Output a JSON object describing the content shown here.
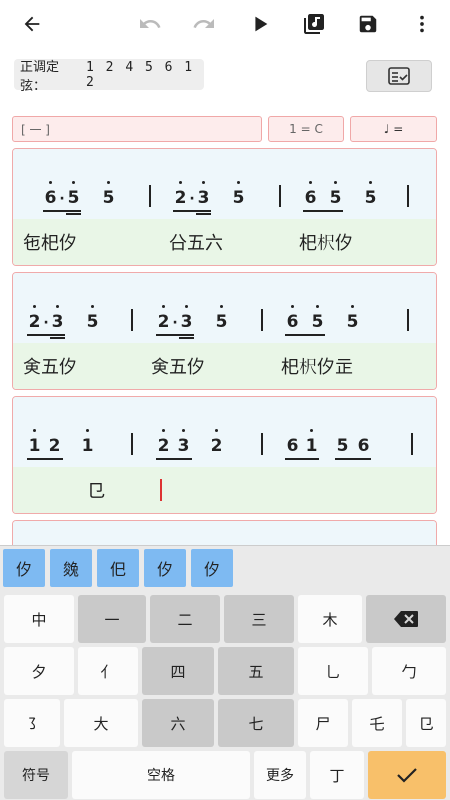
{
  "toolbar": {
    "back_icon": "arrow-back-icon",
    "undo_icon": "undo-icon",
    "redo_icon": "redo-icon",
    "play_icon": "play-icon",
    "music_library_icon": "music-library-icon",
    "save_icon": "save-icon",
    "more_icon": "more-vert-icon"
  },
  "tuning": {
    "label": "正调定弦：",
    "notes": "1 2 4 5 6 1 2"
  },
  "header": {
    "section": "[ 一 ]",
    "key": "1 = C",
    "tempo": "♩ ="
  },
  "measures": [
    {
      "jianpu": [
        "6·5 5",
        "2·3 5",
        "6 5 5"
      ],
      "lyrics": [
        "㐌𣏌㐴",
        "㕣五六",
        "𣏌𣏧㐴"
      ]
    },
    {
      "jianpu": [
        "2·3 5",
        "2·3 5",
        "6 5 5"
      ],
      "lyrics": [
        "㑒五㐴",
        "㑒五㐴",
        "𣏌𣏧㐴㱏"
      ]
    },
    {
      "jianpu": [
        "1 2 1",
        "2 3 2",
        "6 1 5 6"
      ],
      "lyrics": [
        "㔾"
      ]
    }
  ],
  "candidates": [
    "㐴",
    "㕙",
    "㐶",
    "㐴",
    "㐴"
  ],
  "keyboard": {
    "row1": [
      "中",
      "一",
      "二",
      "三",
      "木"
    ],
    "row2": [
      "夕",
      "亻",
      "四",
      "五",
      "乚",
      "勹"
    ],
    "row3": [
      "㇌",
      "大",
      "六",
      "七",
      "尸",
      "乇",
      "㔾"
    ],
    "symbols": "符号",
    "space": "空格",
    "more": "更多",
    "ding": "丁",
    "backspace_icon": "backspace-icon",
    "confirm_icon": "check-icon"
  }
}
